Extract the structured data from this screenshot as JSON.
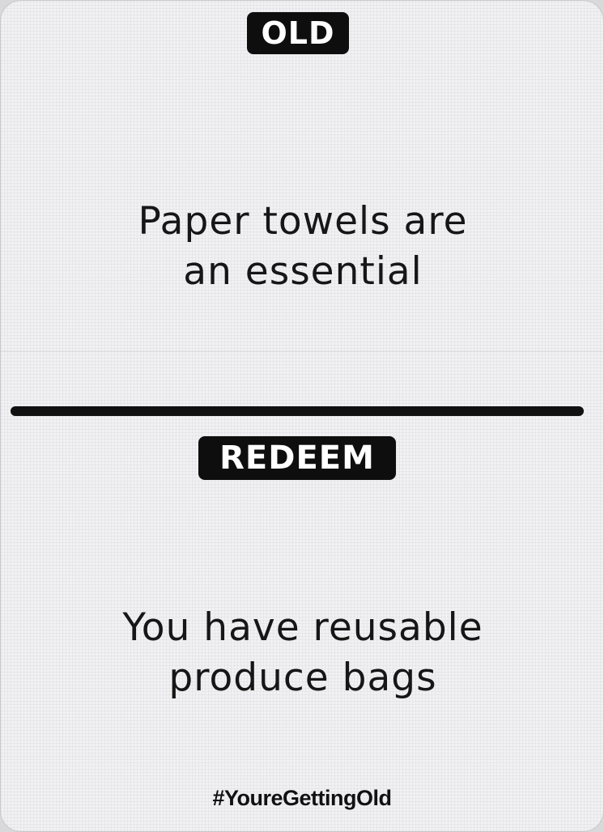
{
  "card": {
    "old_badge": "OLD",
    "old_statement_line1": "Paper towels are",
    "old_statement_line2": "an essential",
    "redeem_badge": "REDEEM",
    "redeem_statement_line1": "You have reusable",
    "redeem_statement_line2": "produce bags",
    "hashtag": "#YoureGettingOld"
  },
  "colors": {
    "card_background": "#f1f1f3",
    "ink": "#111111",
    "badge_text": "#ffffff"
  }
}
